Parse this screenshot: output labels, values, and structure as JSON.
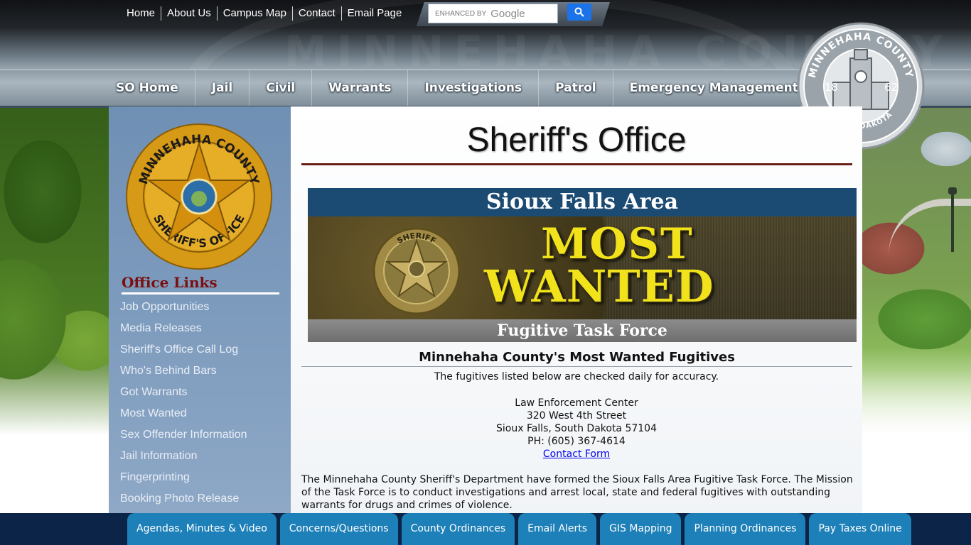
{
  "top_links": [
    "Home",
    "About Us",
    "Campus Map",
    "Contact",
    "Email Page"
  ],
  "search": {
    "placeholder_prefix": "ENHANCED BY",
    "placeholder_brand": "Google"
  },
  "seal": {
    "text_top": "MINNEHAHA COUNTY",
    "year_left": "18",
    "year_right": "62",
    "text_bottom": "SOUTH DAKOTA"
  },
  "nav": [
    "SO Home",
    "Jail",
    "Civil",
    "Warrants",
    "Investigations",
    "Patrol",
    "Emergency Management"
  ],
  "sidebar": {
    "badge_text_top": "MINNEHAHA COUNTY",
    "badge_text_bottom": "SHERIFF'S OFFICE",
    "title": "Office Links",
    "links": [
      "Job Opportunities",
      "Media Releases",
      "Sheriff's Office Call Log",
      "Who's Behind Bars",
      "Got Warrants",
      "Most Wanted",
      "Sex Offender Information",
      "Jail Information",
      "Fingerprinting",
      "Booking Photo Release"
    ]
  },
  "main": {
    "title": "Sheriff's Office",
    "banner": {
      "top": "Sioux Falls Area",
      "line1": "MOST",
      "line2": "WANTED",
      "bottom": "Fugitive Task Force",
      "badge_text": "SHERIFF"
    },
    "heading": "Minnehaha County's Most Wanted Fugitives",
    "subheading": "The fugitives listed below are checked daily for accuracy.",
    "address": {
      "line1": "Law Enforcement Center",
      "line2": "320 West 4th Street",
      "line3": "Sioux Falls, South Dakota 57104",
      "line4": "PH: (605) 367-4614",
      "link": "Contact Form"
    },
    "mission": "The Minnehaha County Sheriff's Department have formed the Sioux Falls Area Fugitive Task Force. The Mission of the Task Force is to conduct investigations and arrest local, state and federal fugitives with outstanding warrants for drugs and crimes of violence."
  },
  "footer": [
    "Agendas, Minutes & Video",
    "Concerns/Questions",
    "County Ordinances",
    "Email Alerts",
    "GIS Mapping",
    "Planning Ordinances",
    "Pay Taxes Online"
  ],
  "colors": {
    "sidebar_bg": "#7d9bbd",
    "office_links_title": "#7a1010",
    "banner_blue": "#1b4a72",
    "most_wanted_yellow": "#f1e21b",
    "footer_bg": "#0b2447",
    "footer_button": "#1e80b8",
    "search_button": "#1a73e8"
  },
  "icons": {
    "search_button": "search-icon"
  }
}
